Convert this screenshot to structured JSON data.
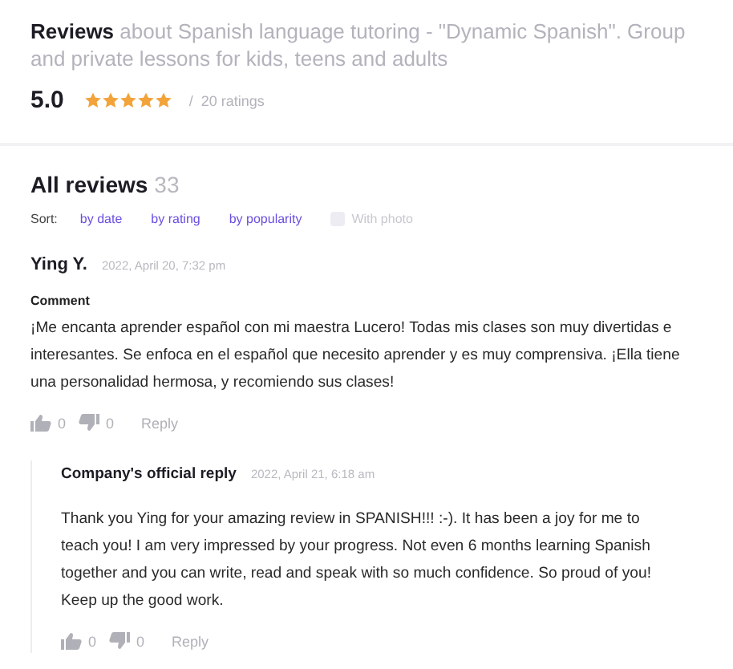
{
  "header": {
    "title": "Reviews",
    "subtitle": "about Spanish language tutoring - \"Dynamic Spanish\". Group and private lessons for kids, teens and adults",
    "score": "5.0",
    "stars": 5,
    "separator": "/",
    "ratings": "20 ratings"
  },
  "reviews_section": {
    "title": "All reviews",
    "count": "33",
    "sort_label": "Sort:",
    "sort_options": [
      "by date",
      "by rating",
      "by popularity"
    ],
    "photo_filter": {
      "label": "With photo",
      "checked": false
    }
  },
  "review": {
    "author": "Ying Y.",
    "date": "2022, April 20, 7:32 pm",
    "comment_label": "Comment",
    "text": "¡Me encanta aprender español con mi maestra Lucero! Todas mis clases son muy divertidas e interesantes. Se enfoca en el español que necesito aprender y es muy comprensiva. ¡Ella tiene una personalidad hermosa, y recomiendo sus clases!",
    "likes": "0",
    "dislikes": "0",
    "reply_label": "Reply"
  },
  "official_reply": {
    "author": "Company's official reply",
    "date": "2022, April 21, 6:18 am",
    "text": "Thank you Ying for your amazing review in SPANISH!!! :-). It has been a joy for me to teach you! I am very impressed by your progress. Not even 6 months learning Spanish together and you can write, read and speak with so much confidence. So proud of you! Keep up the good work.",
    "likes": "0",
    "dislikes": "0",
    "reply_label": "Reply"
  }
}
